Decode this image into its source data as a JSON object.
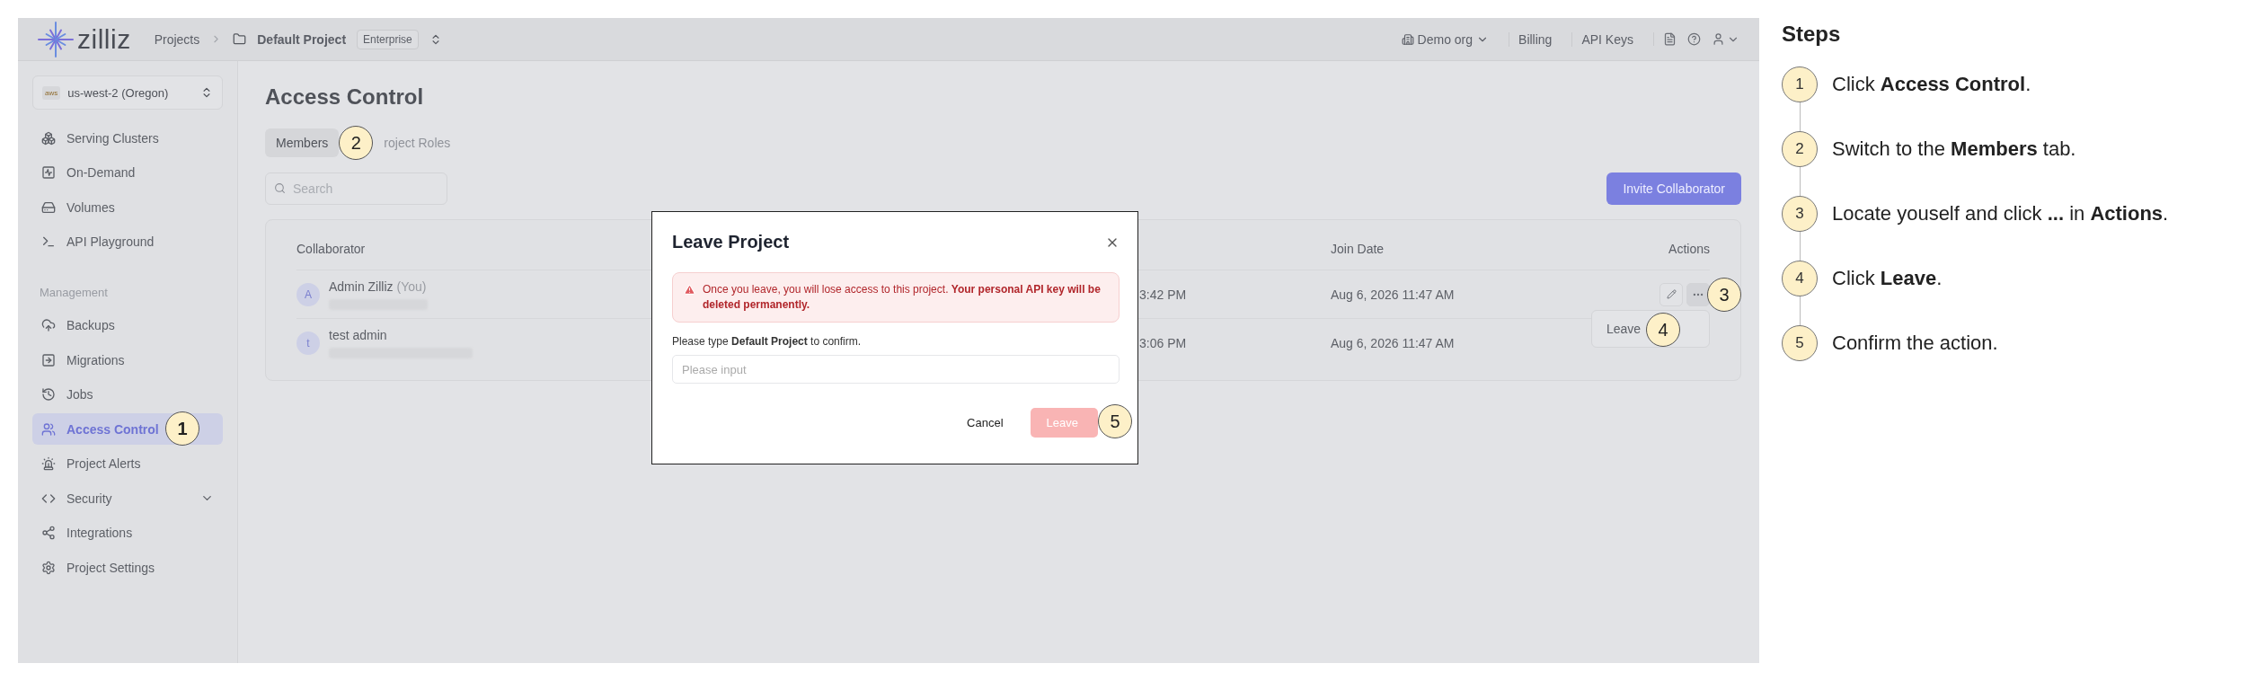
{
  "topbar": {
    "logo": "zilliz",
    "breadcrumb": {
      "root": "Projects",
      "project": "Default Project",
      "plan": "Enterprise"
    },
    "org": "Demo org",
    "links": [
      {
        "label": "Billing"
      },
      {
        "label": "API Keys"
      }
    ]
  },
  "sidebar": {
    "region": {
      "provider": "aws",
      "label": "us-west-2 (Oregon)"
    },
    "sections": [
      {
        "items": [
          {
            "label": "Serving Clusters",
            "selected": false
          },
          {
            "label": "On-Demand",
            "selected": false
          },
          {
            "label": "Volumes",
            "selected": false
          },
          {
            "label": "API Playground",
            "selected": false
          }
        ]
      },
      {
        "heading": "Management",
        "items": [
          {
            "label": "Backups",
            "selected": false
          },
          {
            "label": "Migrations",
            "selected": false
          },
          {
            "label": "Jobs",
            "selected": false
          },
          {
            "label": "Access Control",
            "selected": true,
            "callout": "1"
          },
          {
            "label": "Project Alerts",
            "selected": false
          },
          {
            "label": "Security",
            "selected": false,
            "expanded": false
          },
          {
            "label": "Integrations",
            "selected": false
          },
          {
            "label": "Project Settings",
            "selected": false
          }
        ]
      }
    ]
  },
  "page": {
    "title": "Access Control",
    "tabs": [
      {
        "label": "Members",
        "selected": true,
        "callout": "2"
      },
      {
        "label": "roject Roles",
        "selected": false
      }
    ],
    "search": {
      "placeholder": "Search"
    },
    "invite_button": "Invite Collaborator",
    "table": {
      "columns": {
        "collaborator": "Collaborator",
        "join_date": "Join Date",
        "actions": "Actions"
      },
      "rows": [
        {
          "avatar": "A",
          "name": "Admin Zilliz",
          "tag": "(You)",
          "column_2": "3:42 PM",
          "join_date": "Aug 6, 2026 11:47 AM",
          "actions_shown": true,
          "callout": "3",
          "menu": [
            {
              "label": "Leave",
              "callout": "4"
            }
          ]
        },
        {
          "avatar": "t",
          "name": "test admin",
          "column_2": "3:06 PM",
          "join_date": "Aug 6, 2026 11:47 AM",
          "actions_shown": false
        }
      ]
    }
  },
  "dialog": {
    "title": "Leave Project",
    "warning": "Once you leave, you will lose access to this project. **Your personal API key will be deleted permanently.**",
    "prompt": "Please type **Default Project** to confirm.",
    "input": {
      "placeholder": "Please input"
    },
    "cancel": "Cancel",
    "confirm": {
      "label": "Leave",
      "disabled": true,
      "callout": "5"
    }
  },
  "steps": {
    "title": "Steps",
    "items": [
      {
        "number": "1",
        "text": "Click **Access Control**."
      },
      {
        "number": "2",
        "text": "Switch to the **Members** tab."
      },
      {
        "number": "3",
        "text": "Locate youself and click **...** in **Actions**."
      },
      {
        "number": "4",
        "text": "Click **Leave**."
      },
      {
        "number": "5",
        "text": "Confirm the action."
      }
    ]
  }
}
